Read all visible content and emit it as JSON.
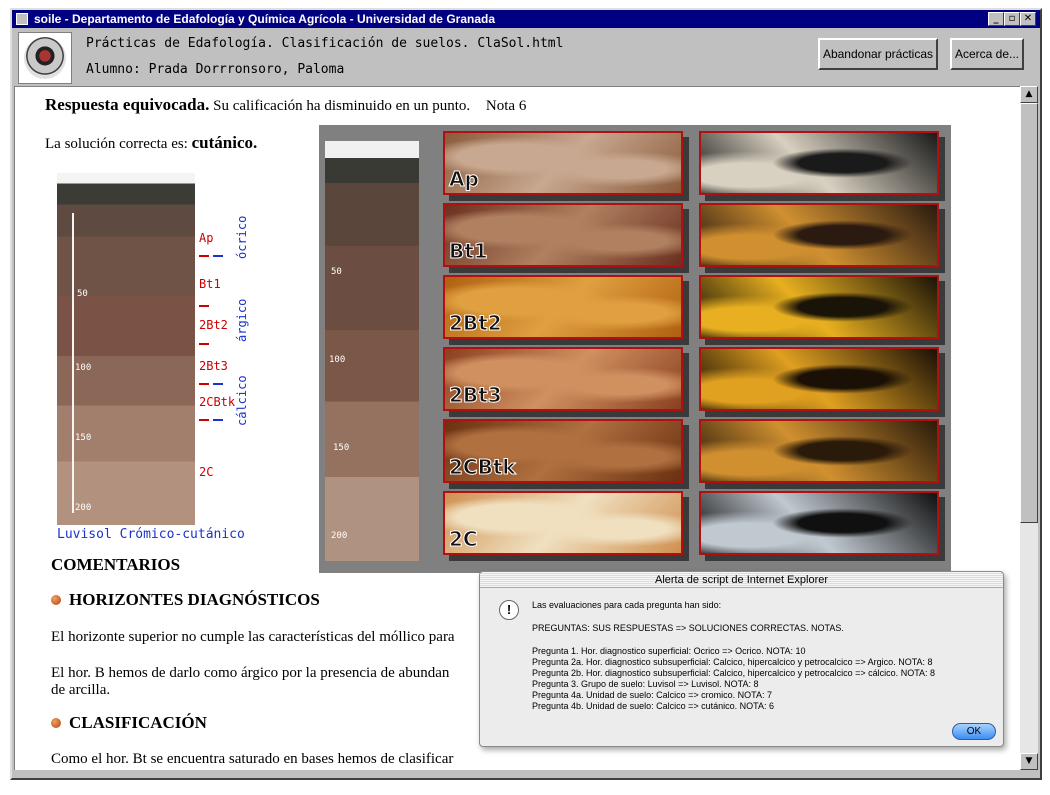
{
  "window": {
    "title": "soile - Departamento de Edafología y Química Agrícola - Universidad de Granada",
    "controls": [
      "_",
      "▫",
      "✕"
    ]
  },
  "header": {
    "line1": "Prácticas de Edafología. Clasificación de suelos. ClaSol.html",
    "line2": "Alumno: Prada Dorrronsoro, Paloma",
    "abandon_label": "Abandonar prácticas",
    "about_label": "Acerca de..."
  },
  "content": {
    "result_bold": "Respuesta equivocada.",
    "result_rest": "Su calificación ha disminuido en un punto.",
    "grade": "Nota 6",
    "solution_prefix": "La solución correcta es:",
    "solution_value": "cutánico.",
    "profile_caption": "Luvisol Crómico-cutánico",
    "profile_depths": [
      "50",
      "100",
      "150",
      "200"
    ],
    "profile_horizons": [
      "Ap",
      "Bt1",
      "2Bt2",
      "2Bt3",
      "2CBtk",
      "2C"
    ],
    "diagnostic_labels": [
      "ócrico",
      "árgico",
      "cálcico"
    ],
    "comments_heading": "COMENTARIOS",
    "section1_title": "HORIZONTES DIAGNÓSTICOS",
    "para1": "El horizonte superior no cumple las características del móllico para",
    "para2": "El hor. B hemos de darlo como árgico por la presencia de abundan",
    "para2_cont": "de arcilla.",
    "section2_title": "CLASIFICACIÓN",
    "para3": "Como el hor. Bt se encuentra saturado en bases hemos de clasificar"
  },
  "plate": {
    "depths": [
      "50",
      "100",
      "150",
      "200"
    ],
    "tiles": [
      {
        "label": "Ap",
        "c1": "#c8a890",
        "c2": "#8a5a3a",
        "x1": "#1a1a1a",
        "x2": "#d8d0c0"
      },
      {
        "label": "Bt1",
        "c1": "#b08060",
        "c2": "#6a3020",
        "x1": "#2a1a10",
        "x2": "#d09030"
      },
      {
        "label": "2Bt2",
        "c1": "#e0a040",
        "c2": "#b06010",
        "x1": "#1a1408",
        "x2": "#e8b020"
      },
      {
        "label": "2Bt3",
        "c1": "#d09060",
        "c2": "#8a4020",
        "x1": "#1a1006",
        "x2": "#e0a020"
      },
      {
        "label": "2CBtk",
        "c1": "#b07040",
        "c2": "#6a3010",
        "x1": "#2a1a0a",
        "x2": "#d09030"
      },
      {
        "label": "2C",
        "c1": "#f0e0c0",
        "c2": "#d09050",
        "x1": "#101010",
        "x2": "#c0c8d0"
      }
    ]
  },
  "dialog": {
    "title": "Alerta de script de Internet Explorer",
    "intro": "Las evaluaciones para cada pregunta han sido:",
    "header": "PREGUNTAS: SUS RESPUESTAS => SOLUCIONES CORRECTAS. NOTAS.",
    "lines": [
      "Pregunta 1. Hor. diagnostico superficial: Ocrico => Ocrico. NOTA: 10",
      "Pregunta 2a. Hor. diagnostico subsuperficial: Calcico, hipercalcico y petrocalcico => Argico. NOTA: 8",
      "Pregunta 2b. Hor. diagnostico subsuperficial: Calcico, hipercalcico y petrocalcico => cálcico. NOTA: 8",
      "Pregunta 3. Grupo de suelo: Luvisol => Luvisol. NOTA: 8",
      "Pregunta 4a. Unidad de suelo: Calcico => cromico. NOTA: 7",
      "Pregunta 4b. Unidad de suelo: Calcico => cutánico. NOTA: 6"
    ],
    "ok_label": "OK"
  }
}
